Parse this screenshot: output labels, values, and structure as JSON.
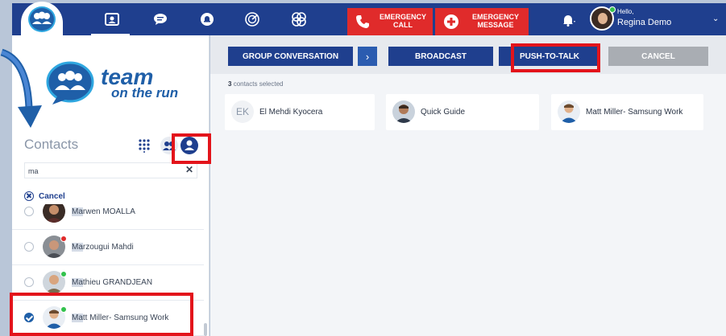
{
  "header": {
    "nav": [
      {
        "name": "contacts-tab-icon"
      },
      {
        "name": "chat-tab-icon"
      },
      {
        "name": "alerts-tab-icon"
      },
      {
        "name": "radar-tab-icon"
      },
      {
        "name": "apps-tab-icon"
      }
    ],
    "emergency_call": {
      "line1": "EMERGENCY",
      "line2": "CALL"
    },
    "emergency_message": {
      "line1": "EMERGENCY",
      "line2": "MESSAGE"
    },
    "greeting": "Hello,",
    "user_name": "Regina Demo"
  },
  "sidebar": {
    "brand_line1": "team",
    "brand_line2": "on the run",
    "contacts_title": "Contacts",
    "search": {
      "value": "ma"
    },
    "cancel_label": "Cancel",
    "contacts": [
      {
        "prefix": "Ma",
        "rest": "rwen MOALLA",
        "checked": false
      },
      {
        "prefix": "Ma",
        "rest": "rzougui Mahdi",
        "checked": false
      },
      {
        "prefix": "Ma",
        "rest": "thieu GRANDJEAN",
        "checked": false
      },
      {
        "prefix": "Ma",
        "rest": "tt Miller- Samsung Work",
        "checked": true
      }
    ]
  },
  "main": {
    "actions": {
      "group_conversation": "GROUP CONVERSATION",
      "broadcast": "BROADCAST",
      "push_to_talk": "PUSH-TO-TALK",
      "cancel": "CANCEL"
    },
    "selected_count": "3",
    "selected_suffix": "contacts selected",
    "selected": [
      {
        "initials": "EK",
        "name": "El Mehdi Kyocera"
      },
      {
        "initials": "",
        "name": "Quick Guide"
      },
      {
        "initials": "",
        "name": "Matt Miller- Samsung Work"
      }
    ]
  },
  "colors": {
    "primary": "#1f3f8e",
    "emergency": "#e02b2b",
    "annotation": "#e3141b",
    "cancel_button": "#a9adb3",
    "presence": "#33c24d"
  }
}
